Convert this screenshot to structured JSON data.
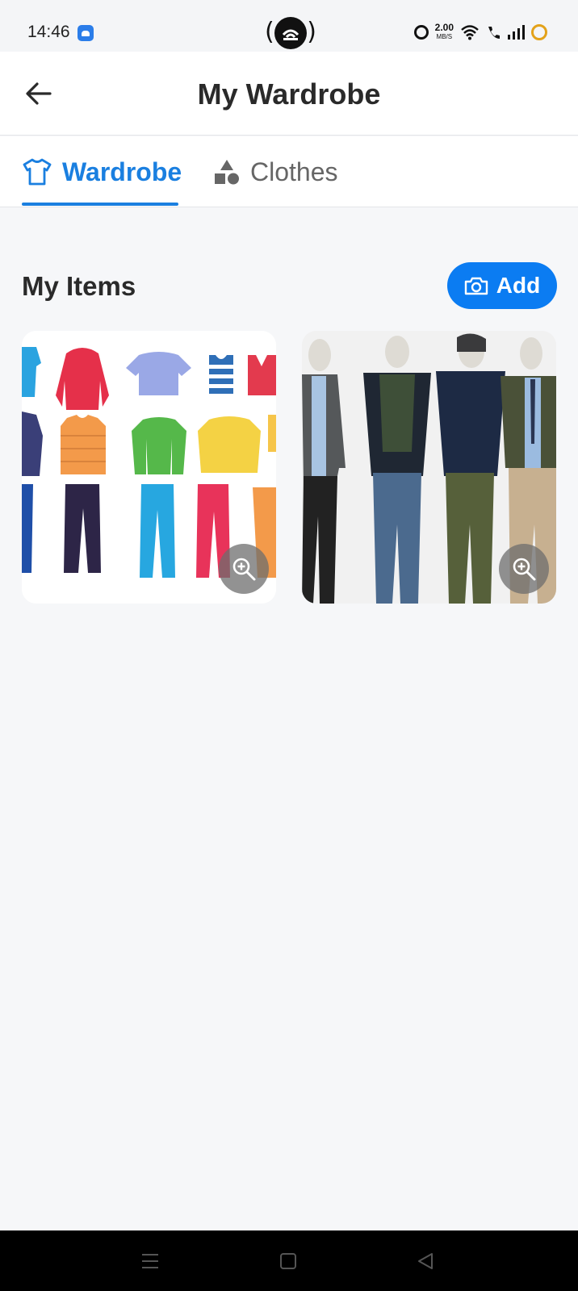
{
  "status_bar": {
    "time": "14:46",
    "net_speed_value": "2.00",
    "net_speed_unit": "MB/S",
    "icons": [
      "app-notification-icon",
      "alarm-icon",
      "wifi-icon",
      "wifi-call-icon",
      "signal-icon",
      "battery-ring-icon"
    ]
  },
  "header": {
    "title": "My Wardrobe",
    "back_icon": "arrow-left-icon"
  },
  "tabs": [
    {
      "label": "Wardrobe",
      "icon": "tshirt-icon",
      "selected": true
    },
    {
      "label": "Clothes",
      "icon": "shapes-icon",
      "selected": false
    }
  ],
  "section": {
    "title": "My Items",
    "add_label": "Add",
    "add_icon": "camera-icon"
  },
  "items": [
    {
      "name": "clothes-illustration",
      "zoom_icon": "zoom-in-icon"
    },
    {
      "name": "mannequins-photo",
      "zoom_icon": "zoom-in-icon"
    }
  ],
  "colors": {
    "accent": "#1a7fe0",
    "add_button": "#0b7cf2",
    "background": "#f6f7f9"
  },
  "nav_bar": {
    "icons": [
      "menu-icon",
      "home-square-icon",
      "back-triangle-icon"
    ]
  }
}
